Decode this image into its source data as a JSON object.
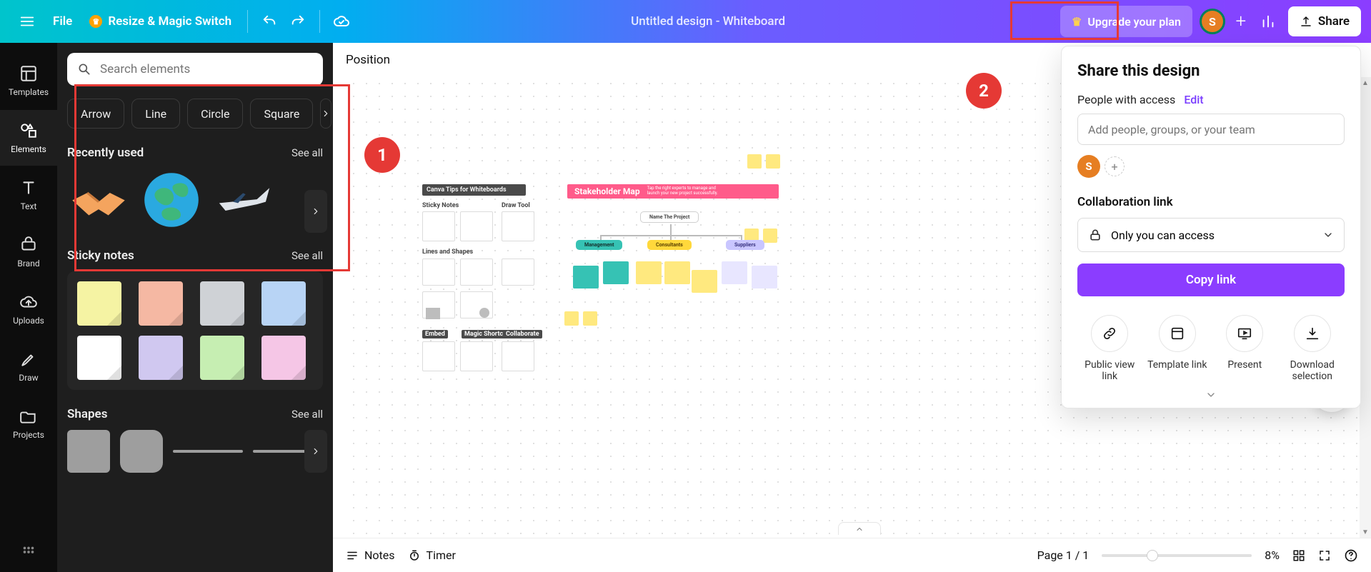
{
  "topbar": {
    "file": "File",
    "resize": "Resize & Magic Switch",
    "doc_title": "Untitled design - Whiteboard",
    "upgrade": "Upgrade your plan",
    "avatar_initial": "S",
    "share": "Share"
  },
  "rail": {
    "templates": "Templates",
    "elements": "Elements",
    "text": "Text",
    "brand": "Brand",
    "uploads": "Uploads",
    "draw": "Draw",
    "projects": "Projects"
  },
  "panel": {
    "search_placeholder": "Search elements",
    "chips": [
      "Arrow",
      "Line",
      "Circle",
      "Square"
    ],
    "recently_used": "Recently used",
    "see_all": "See all",
    "sticky_notes": "Sticky notes",
    "shapes": "Shapes",
    "sticky_colors": [
      "#f5f3a3",
      "#f5b8a3",
      "#cfd2d6",
      "#b8d4f5",
      "#ffffff",
      "#d0c8f0",
      "#c6eeb2",
      "#f5c6e6"
    ]
  },
  "canvas": {
    "position": "Position",
    "tips_header": "Canva Tips for Whiteboards",
    "section_sticky": "Sticky Notes",
    "section_draw": "Draw Tool",
    "section_lines": "Lines and Shapes",
    "section_embed": "Embed",
    "section_magic": "Magic Shortcut",
    "section_collab": "Collaborate",
    "stake_title": "Stakeholder Map",
    "stake_sub1": "Tap the right experts to manage and",
    "stake_sub2": "launch your new project successfully.",
    "name_project": "Name The Project",
    "management": "Management",
    "consultants": "Consultants",
    "suppliers": "Suppliers"
  },
  "share": {
    "title": "Share this design",
    "people_with_access": "People with access",
    "edit": "Edit",
    "add_people_placeholder": "Add people, groups, or your team",
    "avatar_initial": "S",
    "collab_link": "Collaboration link",
    "access_value": "Only you can access",
    "copy_link": "Copy link",
    "opts": {
      "public": "Public view link",
      "template": "Template link",
      "present": "Present",
      "download": "Download selection"
    }
  },
  "bottom": {
    "notes": "Notes",
    "timer": "Timer",
    "page_label": "Page 1 / 1",
    "zoom_label": "8%"
  },
  "callouts": {
    "one": "1",
    "two": "2"
  }
}
